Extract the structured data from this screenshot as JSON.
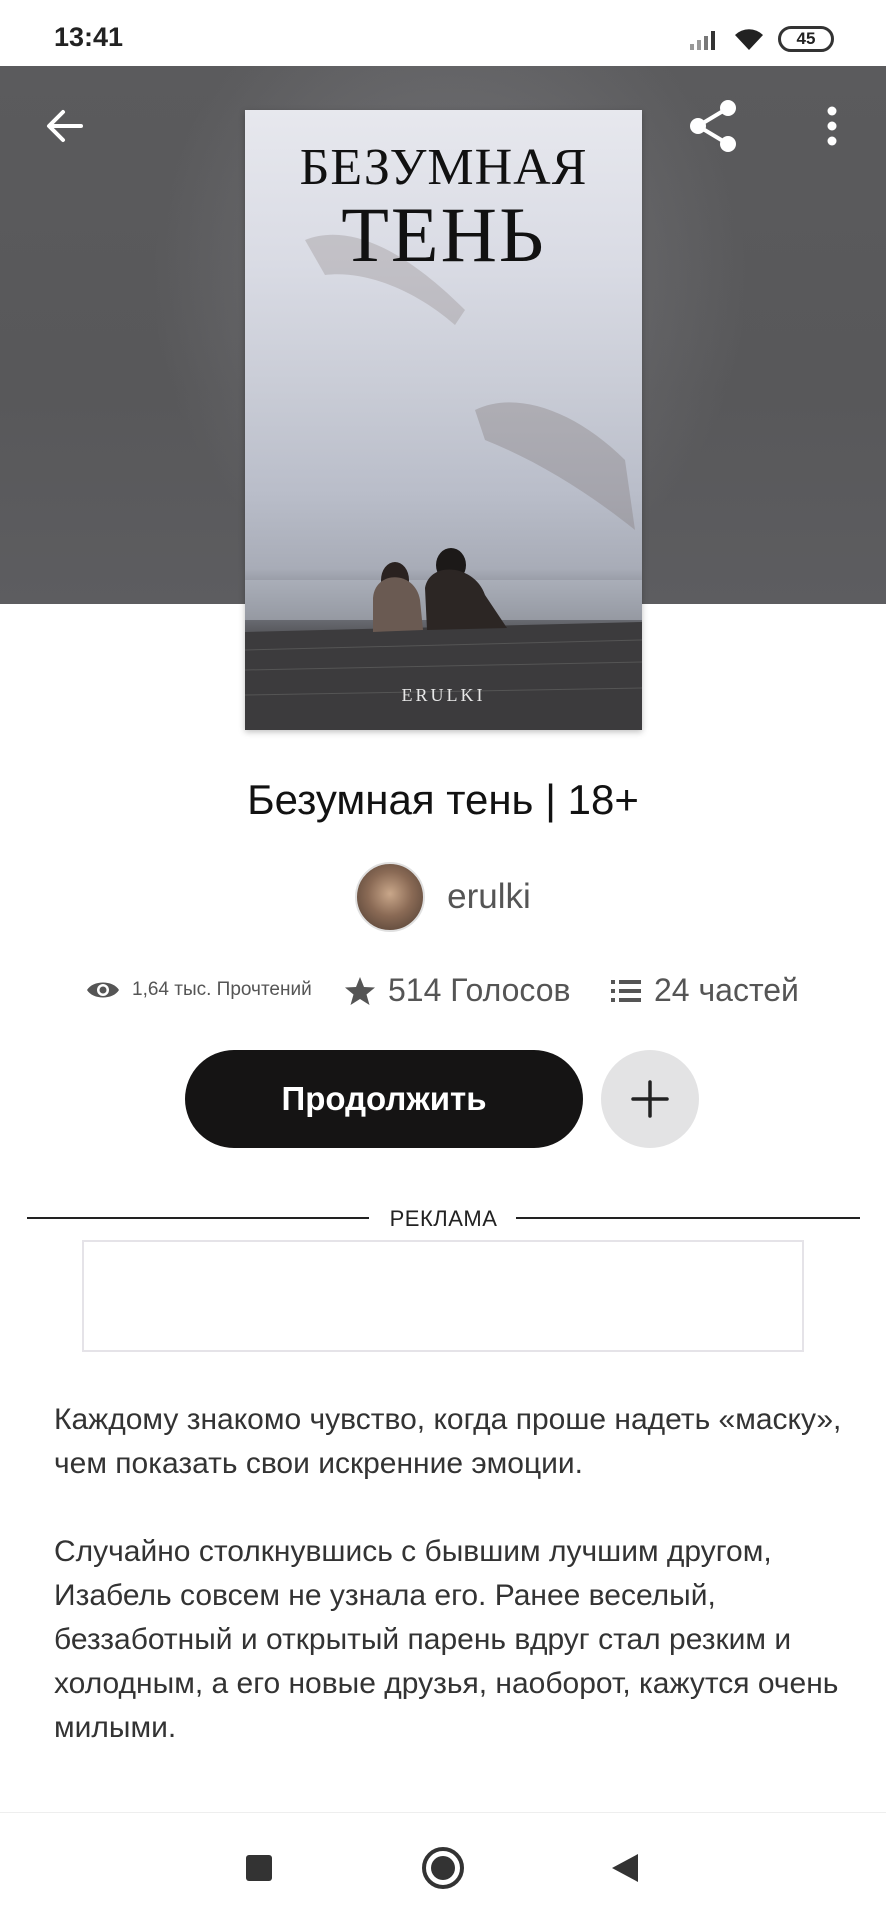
{
  "status_bar": {
    "time": "13:41",
    "battery": "45",
    "icons": [
      "signal-icon",
      "wifi-icon",
      "battery-icon"
    ]
  },
  "header": {
    "back_icon": "arrow-left-icon",
    "share_icon": "share-icon",
    "menu_icon": "more-vertical-icon"
  },
  "cover": {
    "title_line1": "БЕЗУМНАЯ",
    "title_line2": "ТЕНЬ",
    "author": "ERULKI"
  },
  "book": {
    "title": "Безумная тень | 18+",
    "author": "erulki"
  },
  "stats": {
    "reads": "1,64 тыс. Прочтений",
    "votes": "514 Голосов",
    "parts": "24 частей"
  },
  "actions": {
    "continue_label": "Продолжить",
    "add_icon": "plus-icon"
  },
  "ad": {
    "label": "РЕКЛАМА"
  },
  "description": {
    "paragraphs": [
      "Каждому знакомо чувство, когда проше надеть «маску», чем показать свои искренние эмоции.",
      "Случайно столкнувшись с бывшим лучшим другом, Изабель совсем не узнала его. Ранее веселый, беззаботный и открытый парень вдруг стал резким и холодным, а его новые друзья, наоборот, кажутся очень милыми."
    ]
  },
  "nav_bar": {
    "icons": [
      "recent-apps-icon",
      "home-icon",
      "back-triangle-icon"
    ]
  },
  "colors": {
    "header_bg": "#5b5b5d",
    "primary_button": "#151414",
    "secondary_button": "#e3e3e4"
  }
}
